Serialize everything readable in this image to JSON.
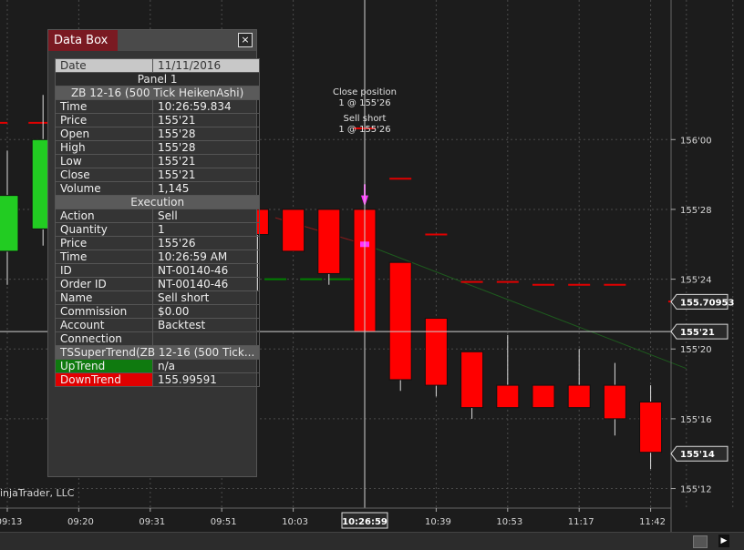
{
  "data_box": {
    "title": "Data Box",
    "close_icon": "×",
    "date_label": "Date",
    "date_value": "11/11/2016",
    "panel_label": "Panel 1",
    "series_title": "ZB 12-16 (500 Tick HeikenAshi)",
    "bar_rows": [
      {
        "key": "Time",
        "value": "10:26:59.834"
      },
      {
        "key": "Price",
        "value": "155'21"
      },
      {
        "key": "Open",
        "value": "155'28"
      },
      {
        "key": "High",
        "value": "155'28"
      },
      {
        "key": "Low",
        "value": "155'21"
      },
      {
        "key": "Close",
        "value": "155'21"
      },
      {
        "key": "Volume",
        "value": "1,145"
      }
    ],
    "execution_title": "Execution",
    "exec_rows": [
      {
        "key": "Action",
        "value": "Sell"
      },
      {
        "key": "Quantity",
        "value": "1"
      },
      {
        "key": "Price",
        "value": "155'26"
      },
      {
        "key": "Time",
        "value": "10:26:59 AM"
      },
      {
        "key": "ID",
        "value": "NT-00140-46"
      },
      {
        "key": "Order ID",
        "value": "NT-00140-46"
      },
      {
        "key": "Name",
        "value": "Sell short"
      },
      {
        "key": "Commission",
        "value": "$0.00"
      },
      {
        "key": "Account",
        "value": "Backtest"
      },
      {
        "key": "Connection",
        "value": ""
      }
    ],
    "indicator_title": "TSSuperTrend(ZB 12-16 (500 Tick...",
    "uptrend_label": "UpTrend",
    "uptrend_value": "n/a",
    "downtrend_label": "DownTrend",
    "downtrend_value": "155.99591"
  },
  "copyright": "injaTrader, LLC",
  "chart_data": {
    "type": "candlestick",
    "y_tick_labels": [
      "156'00",
      "155'28",
      "155'24",
      "155'20",
      "155'16",
      "155'12"
    ],
    "y_tick_values": [
      156.0,
      155.875,
      155.75,
      155.625,
      155.5,
      155.375
    ],
    "ylim": [
      155.34,
      156.25
    ],
    "x_tick_labels": [
      "09:13",
      "09:20",
      "09:31",
      "09:51",
      "10:03",
      "10:39",
      "10:53",
      "11:17",
      "11:42"
    ],
    "x_tick_bar_index": [
      0,
      2,
      4,
      6,
      8,
      12,
      14,
      16,
      18
    ],
    "crosshair": {
      "time_label": "10:26:59",
      "bar_index": 10,
      "price_label": "155'21",
      "price_value": 155.65625
    },
    "price_tags": [
      {
        "label": "155.70953",
        "value": 155.70953,
        "color": "#ff0000"
      },
      {
        "label": "155'14",
        "value": 155.4375,
        "color": "#ff0000"
      }
    ],
    "candles": [
      {
        "i": 0,
        "open": 155.9,
        "high": 155.98,
        "low": 155.74,
        "close": 155.8,
        "color": "#22cc22"
      },
      {
        "i": 1,
        "open": 155.84,
        "high": 156.08,
        "low": 155.81,
        "close": 156.0,
        "color": "#22cc22"
      },
      {
        "i": 7,
        "open": 155.875,
        "high": 155.9,
        "low": 155.73,
        "close": 155.83,
        "color": "#ff0000"
      },
      {
        "i": 8,
        "open": 155.875,
        "high": 155.875,
        "low": 155.8,
        "close": 155.8,
        "color": "#ff0000"
      },
      {
        "i": 9,
        "open": 155.875,
        "high": 155.875,
        "low": 155.74,
        "close": 155.76,
        "color": "#ff0000"
      },
      {
        "i": 10,
        "open": 155.875,
        "high": 155.875,
        "low": 155.65625,
        "close": 155.65625,
        "color": "#ff0000"
      },
      {
        "i": 11,
        "open": 155.78,
        "high": 155.78,
        "low": 155.55,
        "close": 155.57,
        "color": "#ff0000"
      },
      {
        "i": 12,
        "open": 155.68,
        "high": 155.68,
        "low": 155.54,
        "close": 155.56,
        "color": "#ff0000"
      },
      {
        "i": 13,
        "open": 155.62,
        "high": 155.62,
        "low": 155.5,
        "close": 155.52,
        "color": "#ff0000"
      },
      {
        "i": 14,
        "open": 155.56,
        "high": 155.65,
        "low": 155.52,
        "close": 155.52,
        "color": "#ff0000"
      },
      {
        "i": 15,
        "open": 155.56,
        "high": 155.56,
        "low": 155.52,
        "close": 155.52,
        "color": "#ff0000"
      },
      {
        "i": 16,
        "open": 155.56,
        "high": 155.625,
        "low": 155.52,
        "close": 155.52,
        "color": "#ff0000"
      },
      {
        "i": 17,
        "open": 155.56,
        "high": 155.6,
        "low": 155.47,
        "close": 155.5,
        "color": "#ff0000"
      },
      {
        "i": 18,
        "open": 155.53,
        "high": 155.56,
        "low": 155.41,
        "close": 155.44,
        "color": "#ff0000"
      }
    ],
    "supertrend_up": [
      {
        "i": 6.5,
        "value": 155.75
      },
      {
        "i": 7.5,
        "value": 155.75
      },
      {
        "i": 8.5,
        "value": 155.75
      },
      {
        "i": 9.3,
        "value": 155.75
      }
    ],
    "supertrend_down": [
      {
        "i": -0.3,
        "value": 156.03
      },
      {
        "i": 0.9,
        "value": 156.03
      },
      {
        "i": 10,
        "value": 156.02
      },
      {
        "i": 11,
        "value": 155.93
      },
      {
        "i": 12,
        "value": 155.83
      },
      {
        "i": 13,
        "value": 155.745
      },
      {
        "i": 14,
        "value": 155.745
      },
      {
        "i": 15,
        "value": 155.74
      },
      {
        "i": 16,
        "value": 155.74
      },
      {
        "i": 17,
        "value": 155.74
      },
      {
        "i": 18.8,
        "value": 155.71
      }
    ],
    "execution_marker": {
      "bar_index": 10,
      "price": 155.8125
    },
    "execution_line_start": {
      "i": 7.5,
      "value": 155.86
    },
    "annotations": [
      {
        "text": "Close position",
        "bar_index": 10
      },
      {
        "text": "1 @ 155'26",
        "bar_index": 10
      },
      {
        "text": "Sell short",
        "bar_index": 10
      },
      {
        "text": "1 @ 155'26",
        "bar_index": 10
      }
    ],
    "colors": {
      "up": "#22cc22",
      "down": "#ff0000",
      "supertrend_up": "#008000",
      "supertrend_down": "#e00000",
      "grid": "#4a4a4a",
      "marker": "#ff33ff",
      "crosshair": "#cfcfcf"
    }
  }
}
